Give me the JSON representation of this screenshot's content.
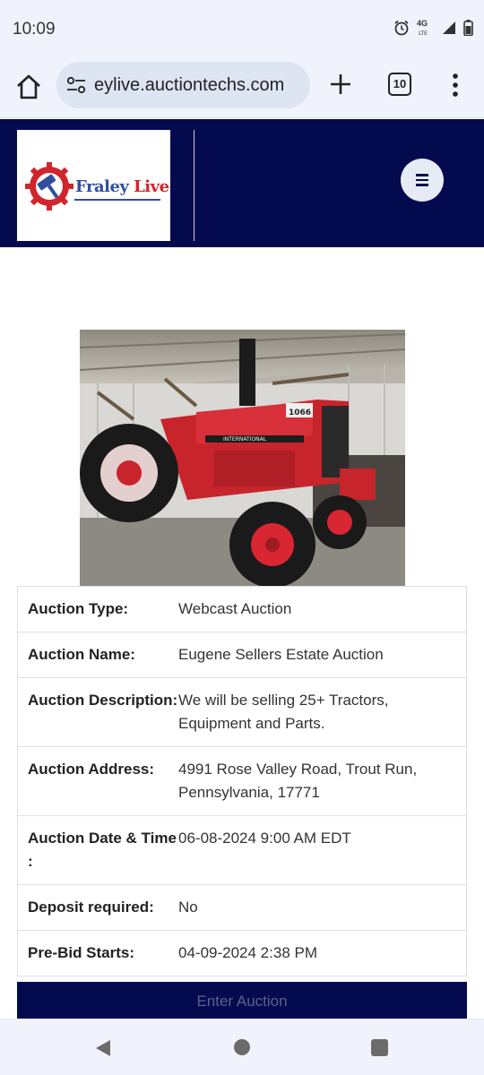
{
  "status_bar": {
    "time": "10:09",
    "network_label": "4G",
    "icons": [
      "alarm-icon",
      "4g-lte-icon",
      "signal-icon",
      "battery-icon"
    ]
  },
  "browser": {
    "url": "eylive.auctiontechs.com",
    "tab_count": "10",
    "icons": [
      "home-icon",
      "site-settings-icon",
      "new-tab-icon",
      "tab-switcher-icon",
      "more-vert-icon"
    ]
  },
  "site_header": {
    "logo_text_primary": "Fraley",
    "logo_text_secondary": "Live",
    "colors": {
      "header_bg": "#030a4e",
      "logo_red": "#d0252d",
      "logo_blue": "#2f4f9e"
    }
  },
  "auction_details": [
    {
      "label": "Auction Type:",
      "value": "Webcast Auction"
    },
    {
      "label": "Auction Name:",
      "value": "Eugene Sellers Estate Auction"
    },
    {
      "label": "Auction Description:",
      "value": "We will be selling 25+ Tractors, Equipment and Parts."
    },
    {
      "label": "Auction Address:",
      "value": "4991 Rose Valley Road, Trout Run, Pennsylvania, 17771"
    },
    {
      "label": "Auction Date & Time :",
      "value": "06-08-2024 9:00 AM EDT"
    },
    {
      "label": "Deposit required:",
      "value": "No"
    },
    {
      "label": "Pre-Bid Starts:",
      "value": "04-09-2024 2:38 PM"
    }
  ],
  "enter_button": "Enter Auction",
  "tractor_badge": "1066",
  "tractor_brand": "INTERNATIONAL"
}
